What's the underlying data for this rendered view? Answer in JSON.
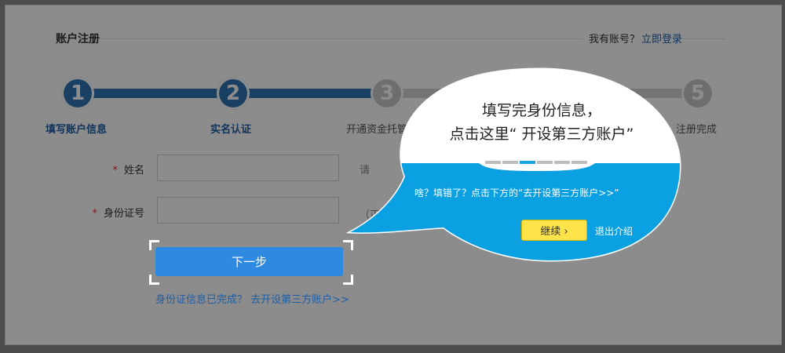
{
  "header": {
    "title": "账户注册",
    "have_account": "我有账号？",
    "login_link": "立即登录"
  },
  "steps": [
    {
      "num": "1",
      "label": "填写账户信息",
      "status": "done"
    },
    {
      "num": "2",
      "label": "实名认证",
      "status": "done"
    },
    {
      "num": "3",
      "label": "开通资金托管",
      "status": "todo"
    },
    {
      "num": "5",
      "label": "注册完成",
      "status": "todo"
    }
  ],
  "form": {
    "name_required": "*",
    "name_label": "姓名",
    "id_required": "*",
    "id_label": "身份证号",
    "hint_1": "请",
    "hint_2": "（正确的",
    "next_button": "下一步",
    "bottom_link": "身份证信息已完成？ 去开设第三方账户>>"
  },
  "tooltip": {
    "title_line1": "填写完身份信息，",
    "title_line2": "点击这里“ 开设第三方账户”",
    "progress_total": 6,
    "progress_active": 3,
    "text": "啥？填错了？点击下方的“去开设第三方账户>>”",
    "continue_button": "继续 ›",
    "exit_link": "退出介绍"
  },
  "colors": {
    "accent_blue": "#2f73b5",
    "button_blue": "#2d8ae0",
    "tooltip_blue": "#0aa0e2",
    "continue_yellow": "#ffe34a",
    "required_red": "#d33"
  }
}
